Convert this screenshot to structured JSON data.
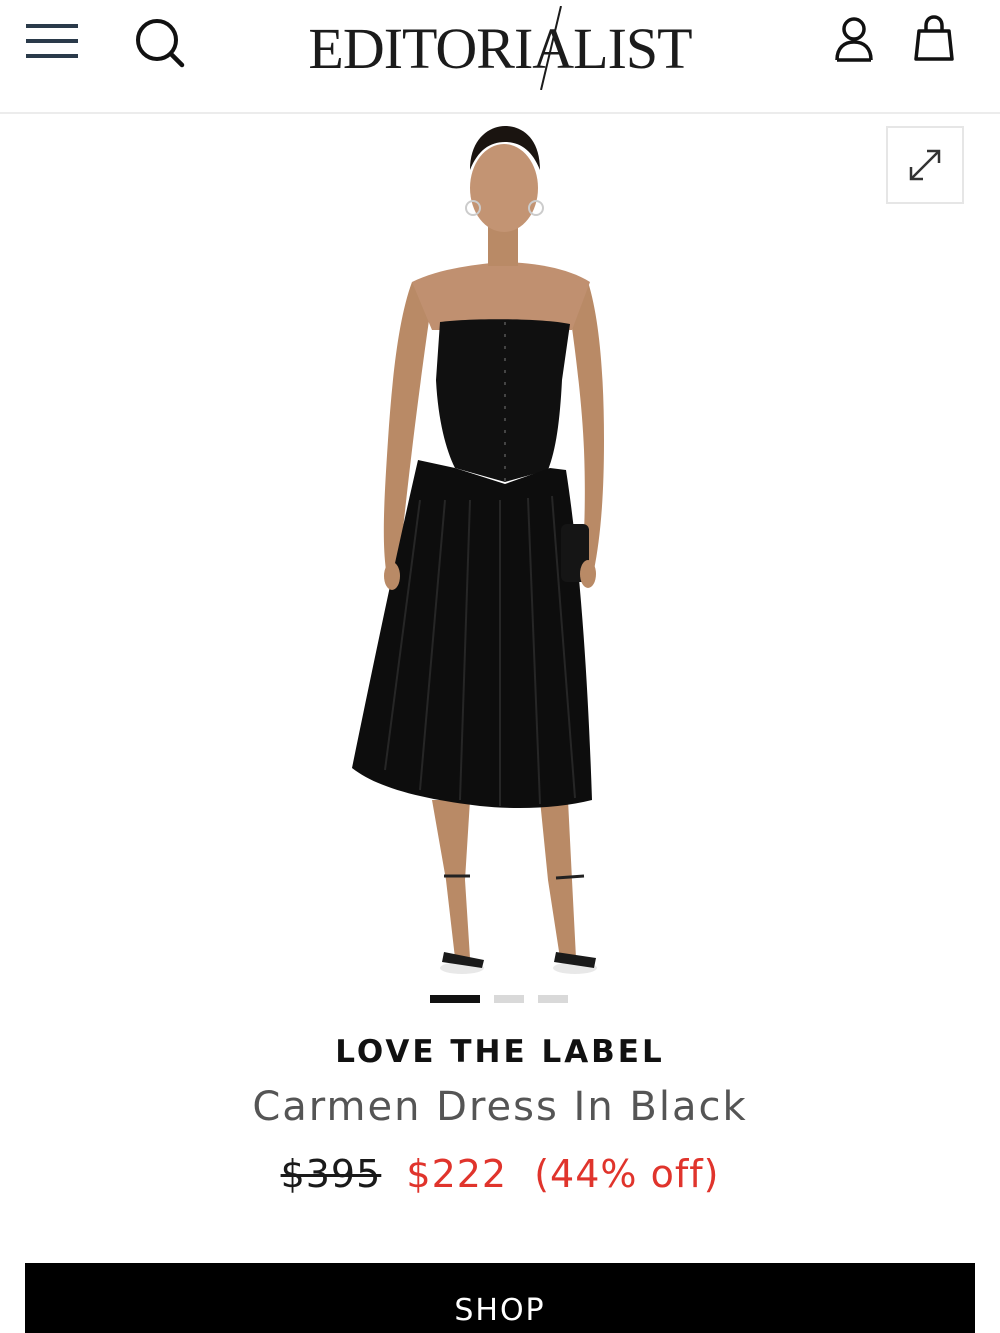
{
  "header": {
    "logo_text": "EDITORIALIST",
    "menu_icon": "menu-icon",
    "search_icon": "search-icon",
    "account_icon": "user-icon",
    "bag_icon": "shopping-bag-icon"
  },
  "gallery": {
    "expand_icon": "expand-icon",
    "image_alt": "Model wearing black strapless velvet corset midi dress",
    "slides_total": 3,
    "active_slide": 1
  },
  "product": {
    "brand": "LOVE THE LABEL",
    "name": "Carmen Dress In Black",
    "price_original": "$395",
    "price_sale": "$222",
    "discount": "(44% off)"
  },
  "actions": {
    "shop_label": "SHOP"
  },
  "colors": {
    "sale_red": "#e0342c",
    "button_black": "#000000"
  }
}
